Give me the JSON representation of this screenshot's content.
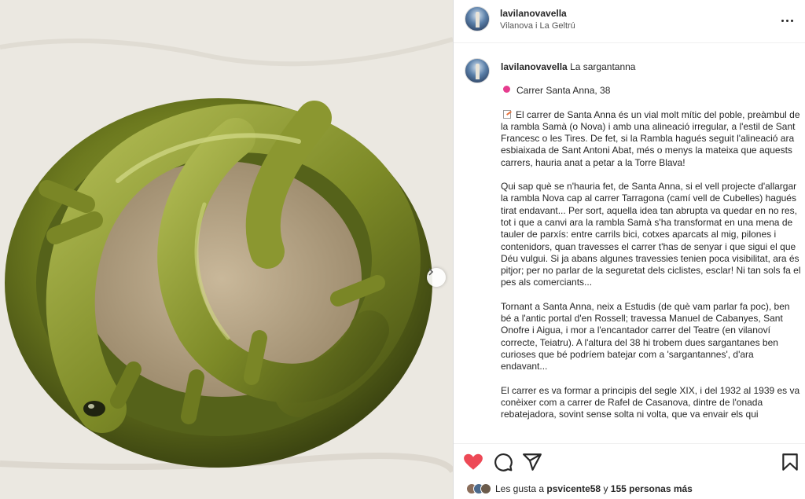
{
  "post": {
    "username": "lavilanovavella",
    "location": "Vilanova i La Geltrú",
    "caption_title": "La sargantanna",
    "address": "Carrer Santa Anna, 38",
    "paragraph1": "El carrer de Santa Anna és un vial molt mític del poble, preàmbul de la rambla Samà (o Nova) i amb una alineació irregular, a l'estil de Sant Francesc o les Tires. De fet, si la Rambla hagués seguit l'alineació ara esbiaixada de Sant Antoni Abat, més o menys la mateixa que aquests carrers, hauria anat a petar a la Torre Blava!",
    "paragraph2": "Qui sap què se n'hauria fet, de Santa Anna, si el vell projecte d'allargar la rambla Nova cap al carrer Tarragona (camí vell de Cubelles) hagués tirat endavant... Per sort, aquella idea tan abrupta va quedar en no res, tot i que a canvi ara la rambla Samà s'ha transformat en una mena de tauler de parxís: entre carrils bici, cotxes aparcats al mig, pilones i contenidors, quan travesses el carrer t'has de senyar i que sigui el que Déu vulgui. Si ja abans algunes travessies tenien poca visibilitat, ara és pitjor; per no parlar de la seguretat dels ciclistes, esclar! Ni tan sols fa el pes als comerciants...",
    "paragraph3": "Tornant a Santa Anna, neix a Estudis (de què vam parlar fa poc), ben bé a l'antic portal d'en Rossell; travessa Manuel de Cabanyes, Sant Onofre i Aigua, i mor a l'encantador carrer del Teatre (en vilanoví correcte, Teiatru). A l'altura del 38 hi trobem dues sargantanes ben curioses que bé podríem batejar com a 'sargantannes', d'ara endavant...",
    "paragraph4": "El carrer es va formar a principis del segle XIX, i del 1932 al 1939 es va conèixer com a carrer de Rafel de Casanova, dintre de l'onada rebatejadora, sovint sense solta ni volta, que va envair els qui"
  },
  "likes": {
    "prefix": "Les gusta a",
    "user": "psvicente58",
    "connector": "y",
    "others": "155 personas más"
  },
  "icons": {
    "more": "more-options-icon",
    "next": "chevron-right-icon",
    "like": "heart-filled-icon",
    "comment": "comment-icon",
    "share": "send-icon",
    "save": "bookmark-icon"
  },
  "colors": {
    "like_red": "#ed4956",
    "text": "#262626",
    "secondary_text": "#555555",
    "glaze_green": "#6b7a1e"
  }
}
